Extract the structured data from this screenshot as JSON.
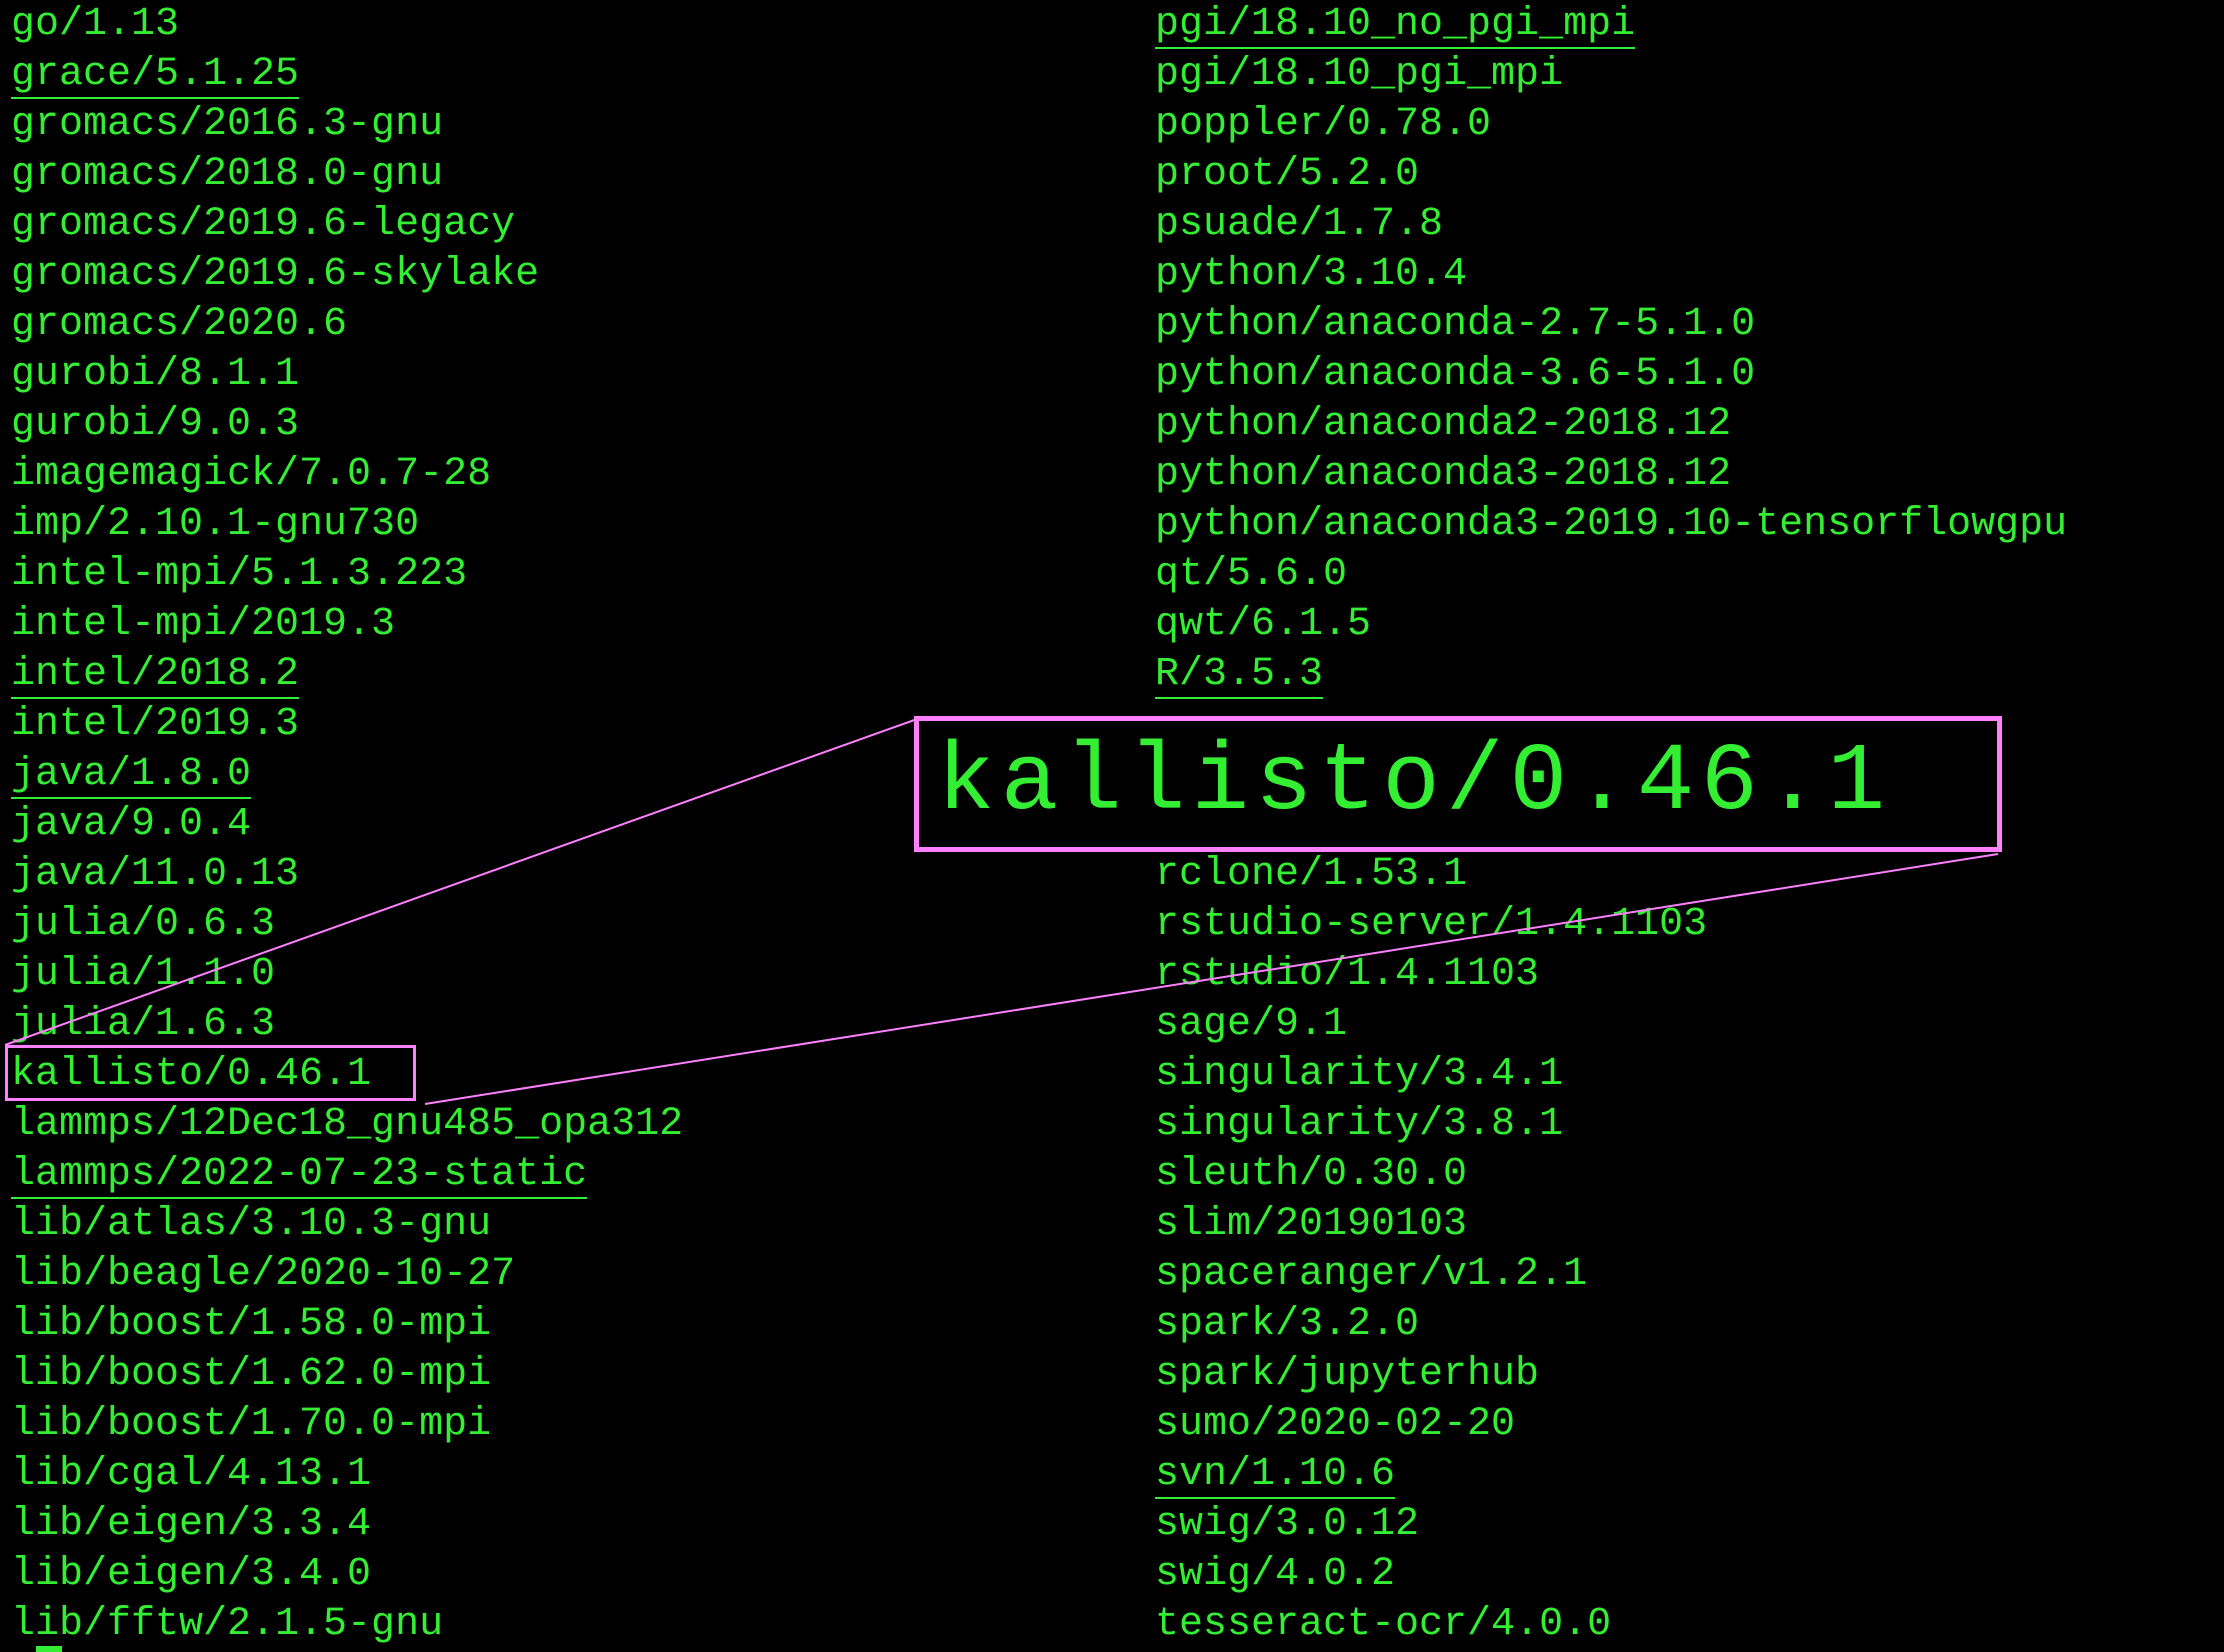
{
  "terminal": {
    "text_color": "#33ee33",
    "background_color": "#000000",
    "highlight_color": "#ff80ff",
    "left_column": [
      {
        "text": "go/1.13",
        "underlined": false
      },
      {
        "text": "grace/5.1.25",
        "underlined": true
      },
      {
        "text": "gromacs/2016.3-gnu",
        "underlined": false
      },
      {
        "text": "gromacs/2018.0-gnu",
        "underlined": false
      },
      {
        "text": "gromacs/2019.6-legacy",
        "underlined": false
      },
      {
        "text": "gromacs/2019.6-skylake",
        "underlined": false
      },
      {
        "text": "gromacs/2020.6",
        "underlined": false
      },
      {
        "text": "gurobi/8.1.1",
        "underlined": false
      },
      {
        "text": "gurobi/9.0.3",
        "underlined": false
      },
      {
        "text": "imagemagick/7.0.7-28",
        "underlined": false
      },
      {
        "text": "imp/2.10.1-gnu730",
        "underlined": false
      },
      {
        "text": "intel-mpi/5.1.3.223",
        "underlined": false
      },
      {
        "text": "intel-mpi/2019.3",
        "underlined": false
      },
      {
        "text": "intel/2018.2",
        "underlined": true
      },
      {
        "text": "intel/2019.3",
        "underlined": false
      },
      {
        "text": "java/1.8.0",
        "underlined": true
      },
      {
        "text": "java/9.0.4",
        "underlined": false
      },
      {
        "text": "java/11.0.13",
        "underlined": false
      },
      {
        "text": "julia/0.6.3",
        "underlined": false
      },
      {
        "text": "julia/1.1.0",
        "underlined": false
      },
      {
        "text": "julia/1.6.3",
        "underlined": false
      },
      {
        "text": "kallisto/0.46.1",
        "underlined": false
      },
      {
        "text": "lammps/12Dec18_gnu485_opa312",
        "underlined": false
      },
      {
        "text": "lammps/2022-07-23-static",
        "underlined": true
      },
      {
        "text": "lib/atlas/3.10.3-gnu",
        "underlined": false
      },
      {
        "text": "lib/beagle/2020-10-27",
        "underlined": false
      },
      {
        "text": "lib/boost/1.58.0-mpi",
        "underlined": false
      },
      {
        "text": "lib/boost/1.62.0-mpi",
        "underlined": false
      },
      {
        "text": "lib/boost/1.70.0-mpi",
        "underlined": false
      },
      {
        "text": "lib/cgal/4.13.1",
        "underlined": false
      },
      {
        "text": "lib/eigen/3.3.4",
        "underlined": false
      },
      {
        "text": "lib/eigen/3.4.0",
        "underlined": false
      },
      {
        "text": "lib/fftw/2.1.5-gnu",
        "underlined": false
      }
    ],
    "right_column": [
      {
        "text": "pgi/18.10_no_pgi_mpi",
        "underlined": true
      },
      {
        "text": "pgi/18.10_pgi_mpi",
        "underlined": false
      },
      {
        "text": "poppler/0.78.0",
        "underlined": false
      },
      {
        "text": "proot/5.2.0",
        "underlined": false
      },
      {
        "text": "psuade/1.7.8",
        "underlined": false
      },
      {
        "text": "python/3.10.4",
        "underlined": false
      },
      {
        "text": "python/anaconda-2.7-5.1.0",
        "underlined": false
      },
      {
        "text": "python/anaconda-3.6-5.1.0",
        "underlined": false
      },
      {
        "text": "python/anaconda2-2018.12",
        "underlined": false
      },
      {
        "text": "python/anaconda3-2018.12",
        "underlined": false
      },
      {
        "text": "python/anaconda3-2019.10-tensorflowgpu",
        "underlined": false
      },
      {
        "text": "qt/5.6.0",
        "underlined": false
      },
      {
        "text": "qwt/6.1.5",
        "underlined": false
      },
      {
        "text": "R/3.5.3",
        "underlined": true
      },
      {
        "text": "",
        "underlined": false
      },
      {
        "text": "",
        "underlined": false
      },
      {
        "text": "",
        "underlined": false
      },
      {
        "text": "rclone/1.53.1",
        "underlined": false
      },
      {
        "text": "rstudio-server/1.4.1103",
        "underlined": false
      },
      {
        "text": "rstudio/1.4.1103",
        "underlined": false
      },
      {
        "text": "sage/9.1",
        "underlined": false
      },
      {
        "text": "singularity/3.4.1",
        "underlined": false
      },
      {
        "text": "singularity/3.8.1",
        "underlined": false
      },
      {
        "text": "sleuth/0.30.0",
        "underlined": false
      },
      {
        "text": "slim/20190103",
        "underlined": false
      },
      {
        "text": "spaceranger/v1.2.1",
        "underlined": false
      },
      {
        "text": "spark/3.2.0",
        "underlined": false
      },
      {
        "text": "spark/jupyterhub",
        "underlined": false
      },
      {
        "text": "sumo/2020-02-20",
        "underlined": false
      },
      {
        "text": "svn/1.10.6",
        "underlined": true
      },
      {
        "text": "swig/3.0.12",
        "underlined": false
      },
      {
        "text": "swig/4.0.2",
        "underlined": false
      },
      {
        "text": "tesseract-ocr/4.0.0",
        "underlined": false
      }
    ],
    "zoom_callout": {
      "text": "kallisto/0.46.1"
    }
  }
}
